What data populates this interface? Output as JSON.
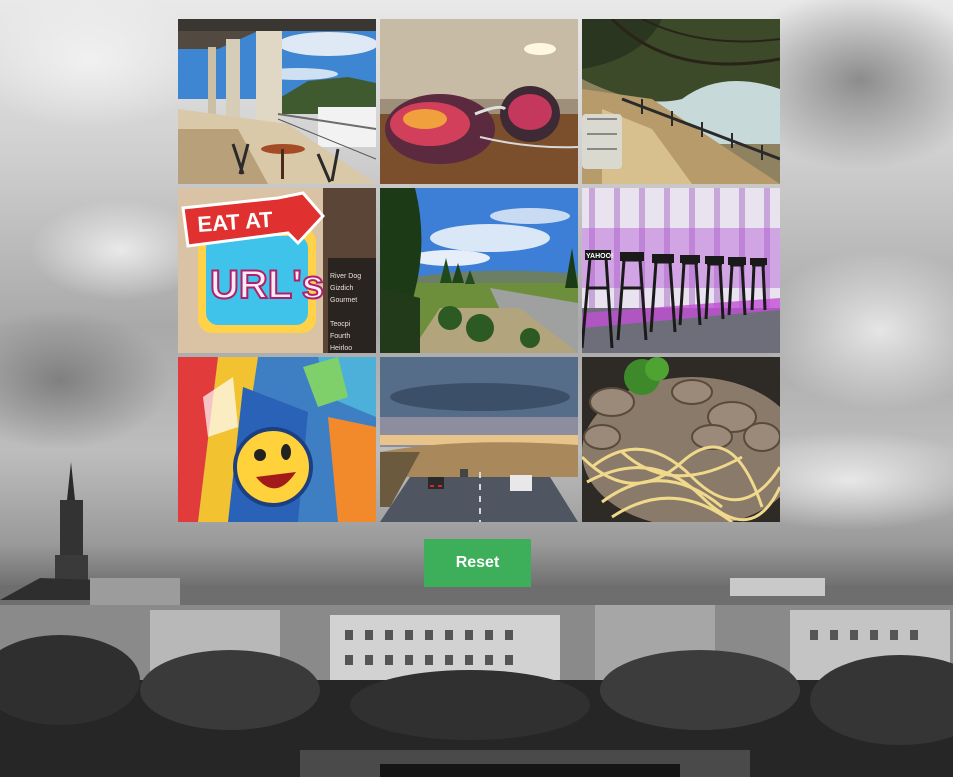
{
  "puzzle": {
    "reset_label": "Reset",
    "accent_color": "#3dae5a"
  },
  "tiles": {
    "t4": {
      "sign_top": "EAT AT",
      "sign_main": "URL's"
    },
    "t6": {
      "chair_text": "YAHOO!"
    }
  }
}
